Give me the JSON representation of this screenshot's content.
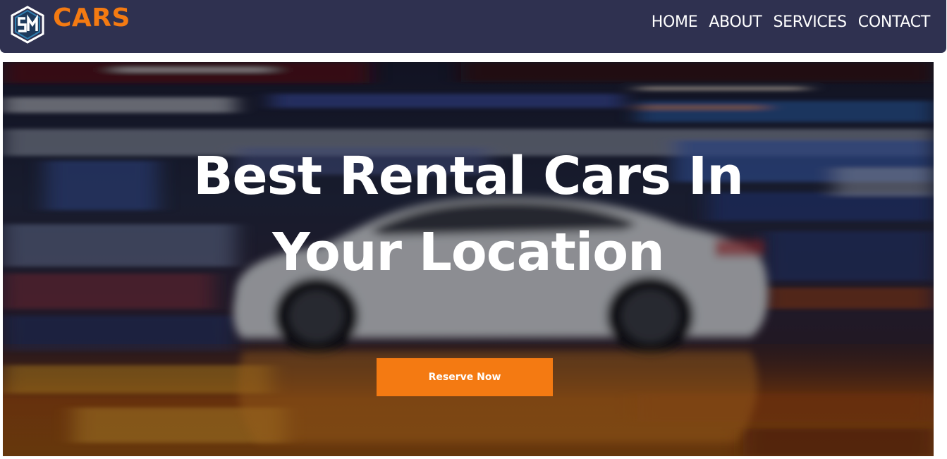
{
  "colors": {
    "navbar_bg": "#2f3150",
    "brand_accent": "#f47a12",
    "nav_text": "#ffffff",
    "button_bg": "#f47a12",
    "hero_text": "#ffffff"
  },
  "header": {
    "logo_icon": "sm-logo-icon",
    "brand_name": "CARS",
    "nav": [
      {
        "label": "HOME"
      },
      {
        "label": "ABOUT"
      },
      {
        "label": "SERVICES"
      },
      {
        "label": "CONTACT"
      }
    ]
  },
  "hero": {
    "background": "blurred-white-car-speed-photo",
    "title_line1": "Best Rental Cars In",
    "title_line2": "Your Location",
    "cta_label": "Reserve Now"
  }
}
